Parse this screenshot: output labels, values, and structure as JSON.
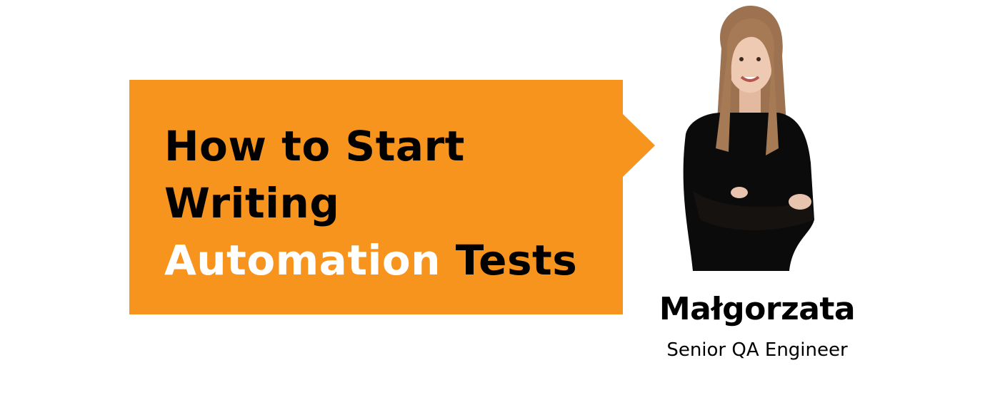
{
  "banner": {
    "title_line1": "How to Start",
    "title_line2": "Writing",
    "title_line3_highlight": "Automation",
    "title_line3_rest": " Tests",
    "accent_color": "#F7941E",
    "highlight_text_color": "#FFFFFF"
  },
  "author": {
    "name": "Małgorzata",
    "role": "Senior QA Engineer",
    "photo": "author-portrait"
  }
}
